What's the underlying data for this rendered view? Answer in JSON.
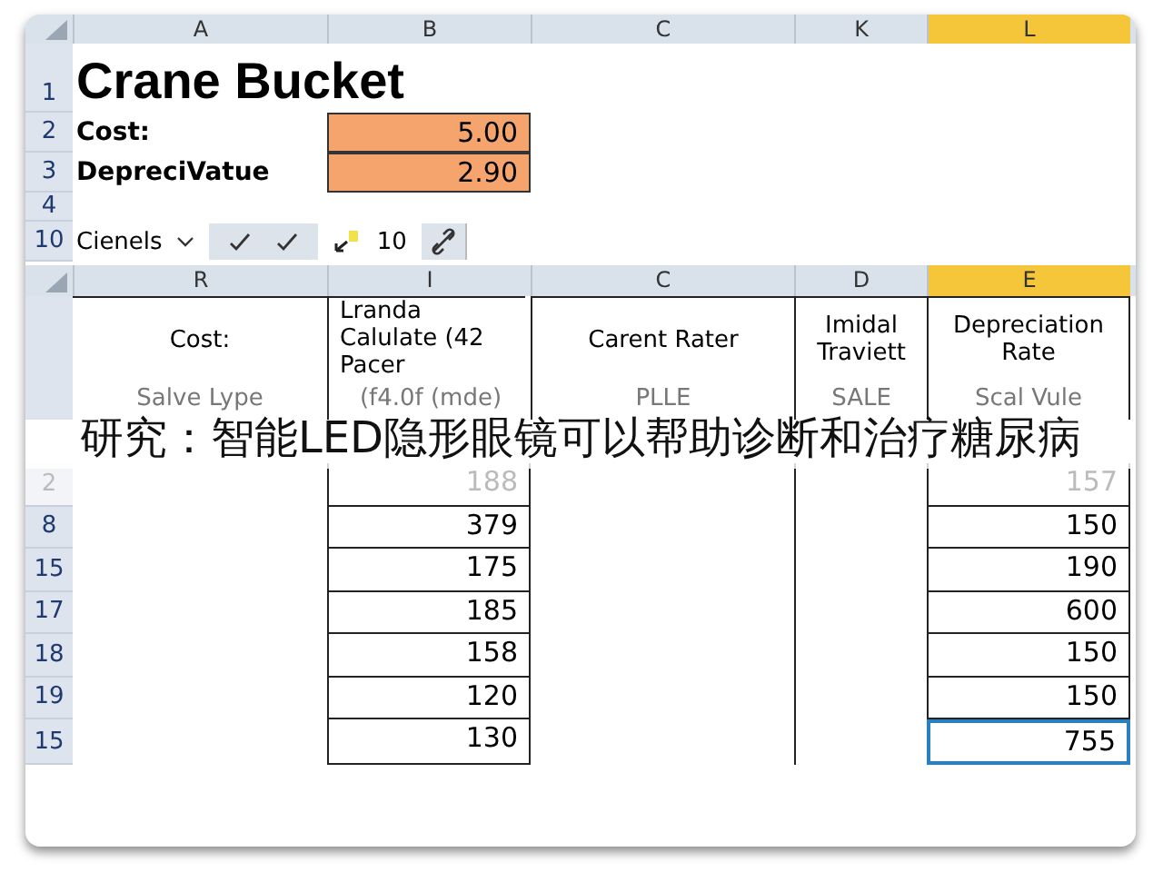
{
  "sheet_top": {
    "columns": [
      {
        "label": "A",
        "selected": false
      },
      {
        "label": "B",
        "selected": false
      },
      {
        "label": "C",
        "selected": false
      },
      {
        "label": "K",
        "selected": false
      },
      {
        "label": "L",
        "selected": true
      }
    ],
    "rows": [
      {
        "num": "1",
        "kind": "title",
        "text": "Crane Bucket"
      },
      {
        "num": "2",
        "kind": "value",
        "label": "Cost:",
        "value": "5.00"
      },
      {
        "num": "3",
        "kind": "value",
        "label": "DepreciVatue",
        "value": "2.90"
      },
      {
        "num": "4",
        "kind": "empty"
      },
      {
        "num": "10",
        "kind": "toolbar",
        "font": "Cienels",
        "size": "10"
      }
    ]
  },
  "sheet_bottom": {
    "columns": [
      {
        "label": "R",
        "selected": false
      },
      {
        "label": "I",
        "selected": false
      },
      {
        "label": "C",
        "selected": false
      },
      {
        "label": "D",
        "selected": false
      },
      {
        "label": "E",
        "selected": true
      }
    ],
    "headers": [
      "Cost:",
      "Lranda Calulate (42 Pacer",
      "Carent Rater",
      "Imidal Traviett",
      "Depreciation Rate"
    ],
    "subheaders": [
      "Salve Lype",
      "(f4.0f (mde)",
      "PLLE",
      "SALE",
      "Scal Vule"
    ],
    "rows": [
      {
        "num": "2",
        "col_i": "188",
        "col_e": "157",
        "faded": true,
        "selected": false
      },
      {
        "num": "8",
        "col_i": "379",
        "col_e": "150",
        "faded": false,
        "selected": false
      },
      {
        "num": "15",
        "col_i": "175",
        "col_e": "190",
        "faded": false,
        "selected": false
      },
      {
        "num": "17",
        "col_i": "185",
        "col_e": "600",
        "faded": false,
        "selected": false
      },
      {
        "num": "18",
        "col_i": "158",
        "col_e": "150",
        "faded": false,
        "selected": false
      },
      {
        "num": "19",
        "col_i": "120",
        "col_e": "150",
        "faded": false,
        "selected": false
      },
      {
        "num": "15",
        "col_i": "130",
        "col_e": "755",
        "faded": false,
        "selected": true
      }
    ]
  },
  "caption": "研究：智能LED隐形眼镜可以帮助诊断和治疗糖尿病"
}
